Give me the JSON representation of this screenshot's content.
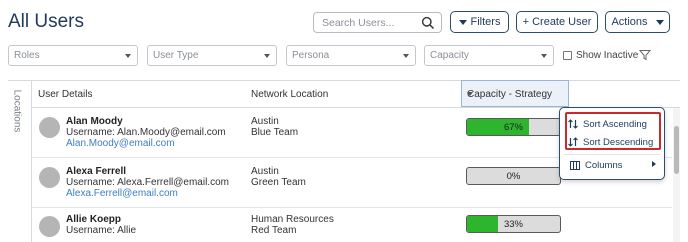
{
  "header": {
    "title": "All Users",
    "search_placeholder": "Search Users...",
    "filters_label": "Filters",
    "create_user_label": "+ Create User",
    "actions_label": "Actions"
  },
  "filters": {
    "roles": "Roles",
    "user_type": "User Type",
    "persona": "Persona",
    "capacity": "Capacity",
    "show_inactive": "Show Inactive",
    "show_inactive_checked": false
  },
  "side_tab": "Locations",
  "columns": {
    "user_details": "User Details",
    "network_location": "Network Location",
    "capacity_strategy": "Capacity - Strategy"
  },
  "users": [
    {
      "name": "Alan Moody",
      "login": "Username: Alan.Moody@email.com",
      "email": "Alan.Moody@email.com",
      "location": "Austin",
      "team": "Blue Team",
      "capacity_label": "67%",
      "capacity": 67
    },
    {
      "name": "Alexa Ferrell",
      "login": "Username: Alexa.Ferrell@email.com",
      "email": "Alexa.Ferrell@email.com",
      "location": "Austin",
      "team": "Green Team",
      "capacity_label": "0%",
      "capacity": 0
    },
    {
      "name": "Allie Koepp",
      "login": "Username: Allie",
      "email": "",
      "location": "Human Resources",
      "team": "Red Team",
      "capacity_label": "33%",
      "capacity": 33
    }
  ],
  "column_menu": {
    "sort_ascending": "Sort Ascending",
    "sort_descending": "Sort Descending",
    "columns": "Columns"
  },
  "colors": {
    "accent": "#1f3a5a",
    "progress_fill": "#2db52d",
    "link": "#3d7fc0",
    "highlight": "#c62c2c"
  }
}
